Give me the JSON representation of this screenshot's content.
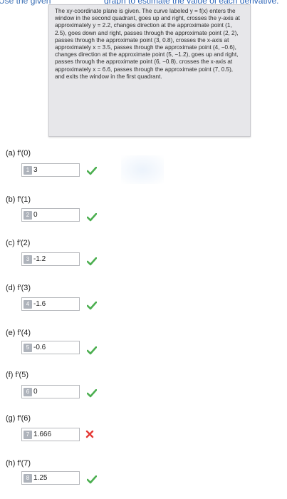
{
  "header": {
    "left_text": "Use the given graph to estimate the value of each derivative.",
    "visible_left": "Use the given",
    "visible_right": "graph to estimate the value of each derivative."
  },
  "description": "The xy-coordinate plane is given. The curve labeled y = f(x) enters the window in the second quadrant, goes up and right, crosses the y-axis at approximately y = 2.2, changes direction at the approximate point (1, 2.5), goes down and right, passes through the approximate point (2, 2), passes through the approximate point (3, 0.8), crosses the x-axis at approximately x = 3.5, passes through the approximate point (4, −0.6), changes direction at the approximate point (5, −1.2), goes up and right, passes through the approximate point (6, −0.8), crosses the x-axis at approximately x = 6.6, passes through the approximate point (7, 0.5), and exits the window in the first quadrant.",
  "parts": [
    {
      "label": "(a)  f′(0)",
      "num": "1",
      "value": "3",
      "status": "correct"
    },
    {
      "label": "(b)  f′(1)",
      "num": "2",
      "value": "0",
      "status": "correct"
    },
    {
      "label": "(c)  f′(2)",
      "num": "3",
      "value": "-1.2",
      "status": "correct"
    },
    {
      "label": "(d)  f′(3)",
      "num": "4",
      "value": "-1.6",
      "status": "correct"
    },
    {
      "label": "(e)  f′(4)",
      "num": "5",
      "value": "-0.6",
      "status": "correct"
    },
    {
      "label": "(f)  f′(5)",
      "num": "6",
      "value": "0",
      "status": "correct"
    },
    {
      "label": "(g)  f′(6)",
      "num": "7",
      "value": "1.666",
      "status": "incorrect"
    },
    {
      "label": "(h)  f′(7)",
      "num": "8",
      "value": "1.25",
      "status": "correct"
    }
  ],
  "colors": {
    "correct": "#4caf50",
    "incorrect": "#e53935",
    "link_blue": "#3a6fb5"
  },
  "icons": {
    "correct": "check-icon",
    "incorrect": "cross-icon"
  }
}
